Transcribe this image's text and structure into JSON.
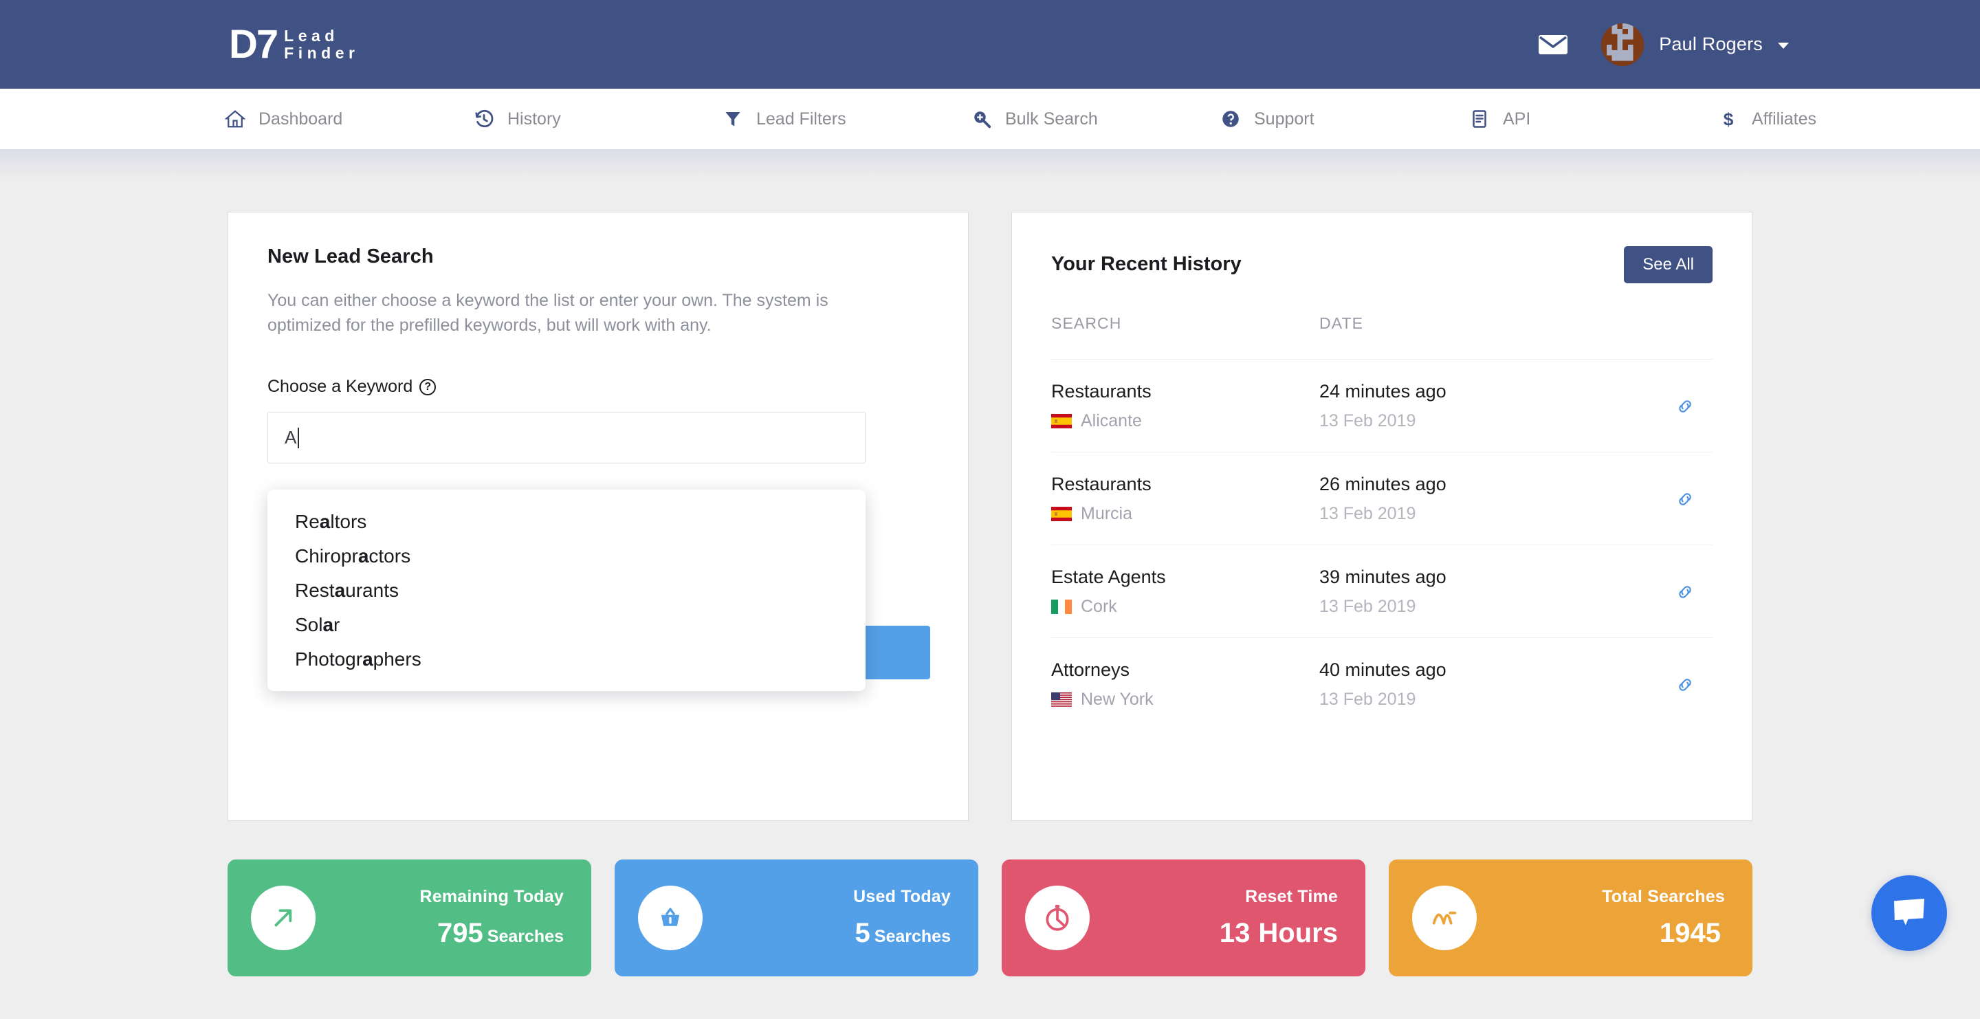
{
  "brand": {
    "logo_mark": "D7",
    "logo_line1": "Lead",
    "logo_line2": "Finder",
    "header_bg": "#405184"
  },
  "header": {
    "mail_icon": "envelope-icon",
    "user_name": "Paul Rogers",
    "chevron_icon": "chevron-down-icon"
  },
  "nav": {
    "items": [
      {
        "label": "Dashboard",
        "icon": "home-icon"
      },
      {
        "label": "History",
        "icon": "clock-history-icon"
      },
      {
        "label": "Lead Filters",
        "icon": "funnel-icon"
      },
      {
        "label": "Bulk Search",
        "icon": "search-plus-icon"
      },
      {
        "label": "Support",
        "icon": "question-circle-icon"
      },
      {
        "label": "API",
        "icon": "document-icon"
      },
      {
        "label": "Affiliates",
        "icon": "dollar-icon"
      }
    ]
  },
  "new_search": {
    "title": "New Lead Search",
    "description": "You can either choose a keyword the list or enter your own. The system is optimized for the prefilled keywords, but will work with any.",
    "keyword_label": "Choose a Keyword",
    "help_icon": "question-circle-icon",
    "keyword_value": "A",
    "keyword_placeholder": "Choose a Keyword",
    "location_placeholder": "",
    "location_value": "",
    "location_icon": "map-pin-icon",
    "search_button_label": "",
    "search_button_color": "#54a0e8",
    "suggestions": [
      {
        "pre": "Re",
        "match": "a",
        "post": "ltors",
        "text": "Realtors"
      },
      {
        "pre": "Chiropr",
        "match": "a",
        "post": "ctors",
        "text": "Chiropractors"
      },
      {
        "pre": "Rest",
        "match": "a",
        "post": "urants",
        "text": "Restaurants"
      },
      {
        "pre": "Sol",
        "match": "a",
        "post": "r",
        "text": "Solar"
      },
      {
        "pre": "Photogr",
        "match": "a",
        "post": "phers",
        "text": "Photographers"
      }
    ]
  },
  "history": {
    "title": "Your Recent History",
    "see_all_label": "See All",
    "columns": {
      "search": "SEARCH",
      "date": "DATE"
    },
    "link_icon": "link-icon",
    "rows": [
      {
        "keyword": "Restaurants",
        "location": "Alicante",
        "flag": "es",
        "ago": "24 minutes ago",
        "date": "13 Feb 2019"
      },
      {
        "keyword": "Restaurants",
        "location": "Murcia",
        "flag": "es",
        "ago": "26 minutes ago",
        "date": "13 Feb 2019"
      },
      {
        "keyword": "Estate Agents",
        "location": "Cork",
        "flag": "ie",
        "ago": "39 minutes ago",
        "date": "13 Feb 2019"
      },
      {
        "keyword": "Attorneys",
        "location": "New York",
        "flag": "us",
        "ago": "40 minutes ago",
        "date": "13 Feb 2019"
      }
    ]
  },
  "stats": [
    {
      "label": "Remaining Today",
      "value": "795",
      "unit": "Searches",
      "color": "#52bd85",
      "icon": "arrow-up-right-icon"
    },
    {
      "label": "Used Today",
      "value": "5",
      "unit": "Searches",
      "color": "#54a0e8",
      "icon": "basket-icon"
    },
    {
      "label": "Reset Time",
      "value": "13",
      "unit": "Hours",
      "color": "#e0566f",
      "icon": "stopwatch-icon"
    },
    {
      "label": "Total Searches",
      "value": "1945",
      "unit": "",
      "color": "#eca438",
      "icon": "chart-line-icon"
    }
  ],
  "chat": {
    "icon": "chat-bubble-icon",
    "color": "#2f73e8"
  }
}
